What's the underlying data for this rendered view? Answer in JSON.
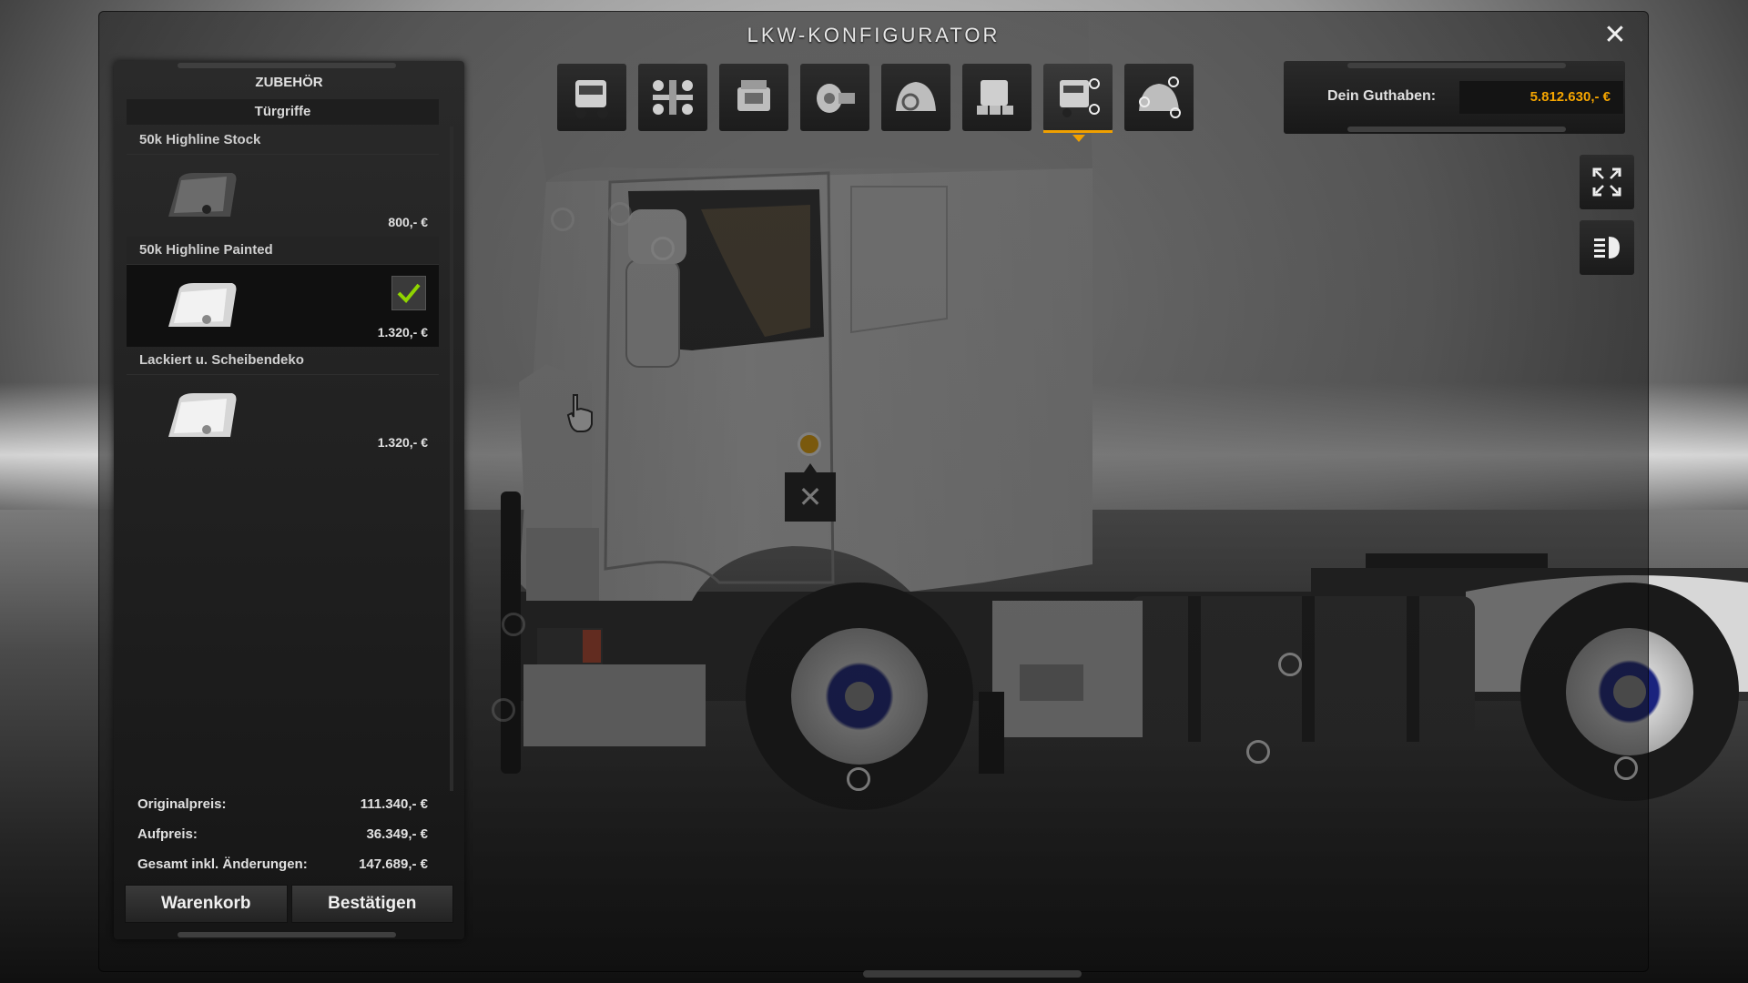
{
  "window": {
    "title": "LKW-KONFIGURATOR"
  },
  "panel": {
    "header": "ZUBEHÖR",
    "subcategory": "Türgriffe",
    "items": [
      {
        "name": "50k Highline Stock",
        "price": "800,- €",
        "selected": false
      },
      {
        "name": "50k Highline Painted",
        "price": "1.320,- €",
        "selected": true
      },
      {
        "name": "Lackiert u. Scheibendeko",
        "price": "1.320,- €",
        "selected": false
      }
    ],
    "totals": [
      {
        "label": "Originalpreis:",
        "value": "111.340,- €"
      },
      {
        "label": "Aufpreis:",
        "value": "36.349,- €"
      },
      {
        "label": "Gesamt inkl. Änderungen:",
        "value": "147.689,- €"
      }
    ],
    "buttons": {
      "cart": "Warenkorb",
      "confirm": "Bestätigen"
    }
  },
  "toolbar": {
    "tools": [
      {
        "icon": "cabin-icon"
      },
      {
        "icon": "chassis-icon"
      },
      {
        "icon": "engine-icon"
      },
      {
        "icon": "transmission-icon"
      },
      {
        "icon": "interior-icon"
      },
      {
        "icon": "paint-icon"
      },
      {
        "icon": "accessories-icon",
        "active": true
      },
      {
        "icon": "interior-accessories-icon"
      }
    ]
  },
  "balance": {
    "label": "Dein Guthaben:",
    "value": "5.812.630,- €"
  },
  "colors": {
    "accent": "#f2a900",
    "balance": "#f5a500",
    "check": "#8fd400"
  }
}
